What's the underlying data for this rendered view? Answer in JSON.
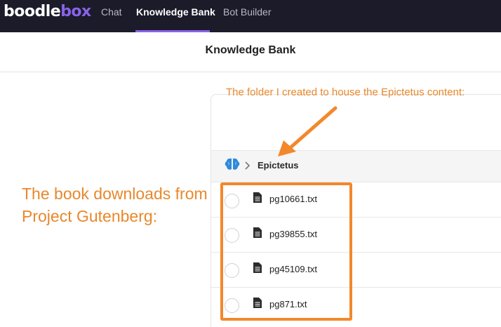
{
  "nav": {
    "logo_main": "boodle",
    "logo_accent": "box",
    "tabs": [
      {
        "label": "Chat",
        "active": false
      },
      {
        "label": "Knowledge Bank",
        "active": true
      },
      {
        "label": "Bot Builder",
        "active": false
      }
    ],
    "accent_color": "#8a63e8",
    "background_color": "#1b1b2a"
  },
  "page": {
    "title": "Knowledge Bank"
  },
  "breadcrumb": {
    "root_icon": "brain-icon",
    "separator_icon": "chevron-right-icon",
    "folder": "Epictetus"
  },
  "files": [
    {
      "name": "pg10661.txt",
      "icon": "document-icon",
      "selected": false
    },
    {
      "name": "pg39855.txt",
      "icon": "document-icon",
      "selected": false
    },
    {
      "name": "pg45109.txt",
      "icon": "document-icon",
      "selected": false
    },
    {
      "name": "pg871.txt",
      "icon": "document-icon",
      "selected": false
    }
  ],
  "annotations": {
    "folder_note": "The folder I created to house the Epictetus content:",
    "books_note": "The book downloads from Project Gutenberg:",
    "color": "#e8882c"
  }
}
